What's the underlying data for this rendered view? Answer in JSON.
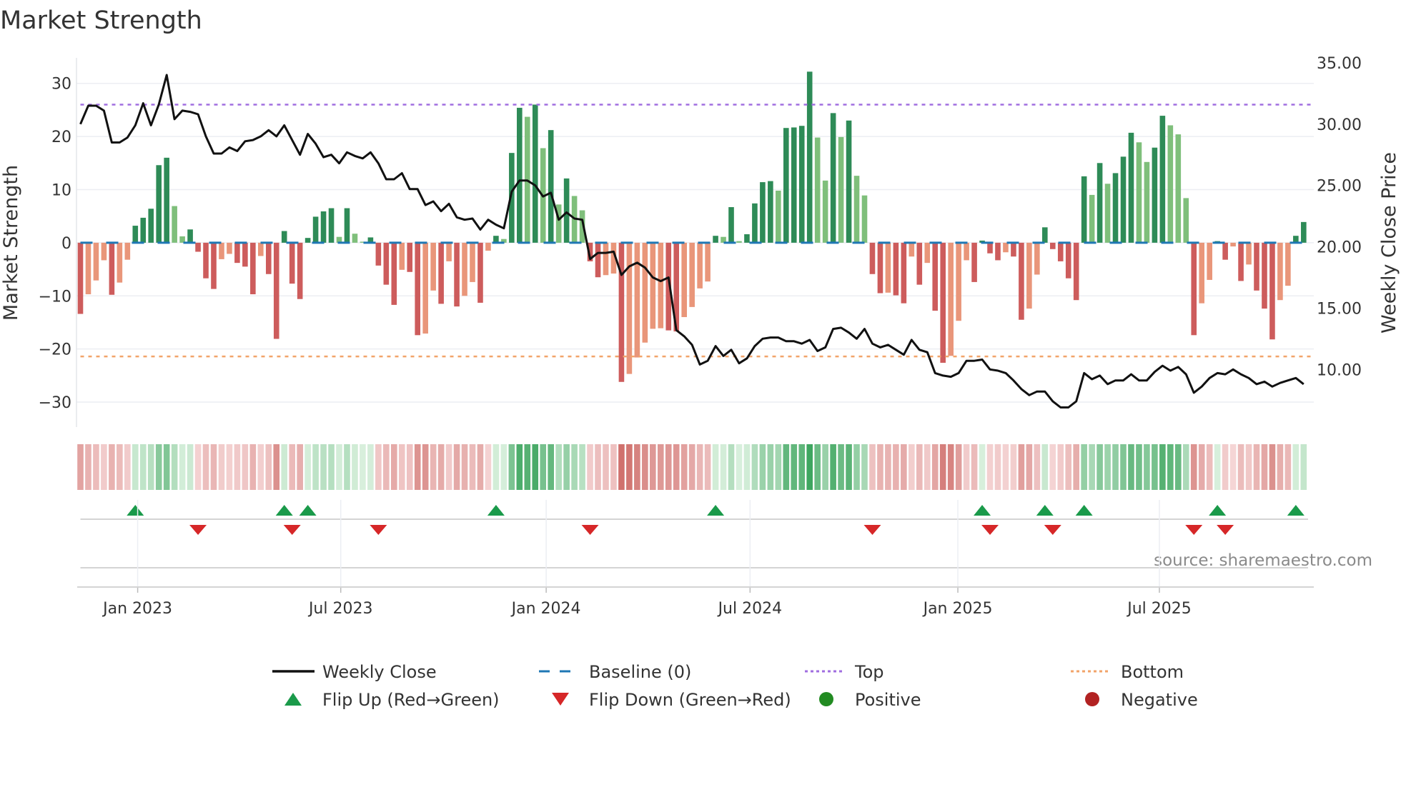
{
  "chart_data": {
    "type": "bar",
    "title": "Market Strength",
    "ylabel": "Market Strength",
    "ylabel_right": "Weekly Close Price",
    "ylim": [
      -34.7,
      34.8
    ],
    "ylim_right": [
      5.3,
      35.4
    ],
    "yticks": [
      30,
      20,
      10,
      0,
      -10,
      -20,
      -30
    ],
    "ytick_labels": [
      "30",
      "20",
      "10",
      "0",
      "−10",
      "−20",
      "−30"
    ],
    "yticks_right": [
      35,
      30,
      25,
      20,
      15,
      10
    ],
    "ytick_labels_right": [
      "35.00",
      "30.00",
      "25.00",
      "20.00",
      "15.00",
      "10.00"
    ],
    "x_unit": "week index (0 = first bar)",
    "xticks": [
      {
        "label": "Jan 2023",
        "week": 7.3
      },
      {
        "label": "Jul 2023",
        "week": 33.2
      },
      {
        "label": "Jan 2024",
        "week": 59.4
      },
      {
        "label": "Jul 2024",
        "week": 85.4
      },
      {
        "label": "Jan 2025",
        "week": 111.9
      },
      {
        "label": "Jul 2025",
        "week": 137.6
      }
    ],
    "top_level": 26,
    "bottom_level": -21.4,
    "grid": true,
    "strength": [
      -13.4,
      -9.7,
      -7.1,
      -3.3,
      -9.8,
      -7.5,
      -3.2,
      3.2,
      4.7,
      6.4,
      14.6,
      16,
      6.9,
      1.2,
      2.5,
      -1.7,
      -6.7,
      -8.7,
      -3.1,
      -2.1,
      -3.8,
      -4.5,
      -9.7,
      -2.5,
      -5.9,
      -18.1,
      2.2,
      -7.7,
      -10.6,
      0.9,
      4.9,
      5.9,
      6.5,
      1.1,
      6.5,
      1.7,
      0.2,
      1,
      -4.3,
      -7.9,
      -11.7,
      -5.1,
      -5.5,
      -17.4,
      -17.1,
      -9,
      -11.5,
      -3.5,
      -12,
      -10,
      -7.4,
      -11.3,
      -1.5,
      1.3,
      0.7,
      16.9,
      25.4,
      23.7,
      26,
      17.8,
      21.2,
      7.2,
      12.1,
      8.8,
      6.1,
      -3.5,
      -6.5,
      -6.1,
      -5.8,
      -26.2,
      -24.7,
      -21.6,
      -18.8,
      -16.2,
      -16.1,
      -16.5,
      -16.7,
      -14,
      -12.1,
      -8.6,
      -7.3,
      1.3,
      1.1,
      6.7,
      0.3,
      1.6,
      7.4,
      11.4,
      11.6,
      9.8,
      21.6,
      21.7,
      22,
      32.2,
      19.8,
      11.7,
      24.4,
      19.9,
      23,
      12.6,
      8.9,
      -5.9,
      -9.5,
      -9.4,
      -9.9,
      -11.4,
      -2.6,
      -7.9,
      -3.8,
      -12.8,
      -22.6,
      -21.3,
      -14.7,
      -3.3,
      -7.4,
      0.4,
      -2,
      -3.3,
      -1.8,
      -2.6,
      -14.5,
      -12.4,
      -6,
      2.9,
      -1.2,
      -3.5,
      -6.7,
      -10.8,
      12.5,
      9,
      15,
      11.1,
      13.1,
      16.2,
      20.7,
      18.9,
      15.2,
      17.9,
      23.9,
      22.1,
      20.4,
      8.4,
      -17.4,
      -11.4,
      -7,
      0.3,
      -3.2,
      -0.7,
      -7.2,
      -4.1,
      -9,
      -12.4,
      -18.2,
      -10.8,
      -8.1,
      1.3,
      3.9
    ],
    "weekly_close": [
      30,
      31.5,
      31.5,
      31.1,
      28.5,
      28.5,
      28.9,
      29.9,
      31.7,
      29.9,
      31.6,
      34,
      30.4,
      31.1,
      31,
      30.8,
      29,
      27.6,
      27.6,
      28.1,
      27.8,
      28.6,
      28.7,
      29,
      29.5,
      29,
      29.9,
      28.7,
      27.5,
      29.2,
      28.4,
      27.3,
      27.5,
      26.8,
      27.7,
      27.4,
      27.2,
      27.7,
      26.8,
      25.5,
      25.5,
      26,
      24.7,
      24.7,
      23.4,
      23.7,
      22.9,
      23.5,
      22.4,
      22.2,
      22.3,
      21.4,
      22.2,
      21.8,
      21.5,
      24.5,
      25.4,
      25.4,
      25,
      24.1,
      24.4,
      22.2,
      22.8,
      22.3,
      22.2,
      19,
      19.5,
      19.5,
      19.6,
      17.7,
      18.4,
      18.7,
      18.3,
      17.5,
      17.2,
      17.5,
      13.2,
      12.7,
      12,
      10.4,
      10.7,
      11.9,
      11.1,
      11.6,
      10.5,
      10.9,
      11.9,
      12.5,
      12.6,
      12.6,
      12.3,
      12.3,
      12.1,
      12.4,
      11.5,
      11.8,
      13.3,
      13.4,
      13,
      12.5,
      13.3,
      12.1,
      11.8,
      12,
      11.6,
      11.2,
      12.4,
      11.6,
      11.4,
      9.7,
      9.5,
      9.4,
      9.7,
      10.7,
      10.7,
      10.8,
      10,
      9.9,
      9.7,
      9.1,
      8.4,
      7.9,
      8.2,
      8.2,
      7.4,
      6.9,
      6.9,
      7.4,
      9.7,
      9.2,
      9.5,
      8.8,
      9.1,
      9.1,
      9.6,
      9.1,
      9.1,
      9.8,
      10.3,
      9.9,
      10.2,
      9.6,
      8.1,
      8.6,
      9.3,
      9.7,
      9.6,
      10,
      9.6,
      9.3,
      8.8,
      9,
      8.6,
      8.9,
      9.1,
      9.3,
      8.8
    ],
    "flip_up_weeks": [
      7,
      26,
      29,
      53,
      81,
      115,
      123,
      128,
      145,
      155
    ],
    "flip_down_weeks": [
      15,
      27,
      38,
      65,
      101,
      116,
      124,
      142,
      146
    ],
    "legend": {
      "placement": "bottom",
      "items": [
        {
          "label": "Weekly Close",
          "kind": "solid-line",
          "color": "#111111"
        },
        {
          "label": "Baseline (0)",
          "kind": "dashed-line",
          "color": "#1f77b4"
        },
        {
          "label": "Top",
          "kind": "dotted-line",
          "color": "#a06ee0"
        },
        {
          "label": "Bottom",
          "kind": "dotted-line",
          "color": "#f2a46a"
        },
        {
          "label": "Flip Up (Red→Green)",
          "kind": "triangle-up",
          "color": "#1a9a4a"
        },
        {
          "label": "Flip Down (Green→Red)",
          "kind": "triangle-down",
          "color": "#d62728"
        },
        {
          "label": "Positive",
          "kind": "dot",
          "color": "#228b22"
        },
        {
          "label": "Negative",
          "kind": "dot",
          "color": "#b22222"
        }
      ]
    },
    "colors": {
      "pos_strong": "#2e8b57",
      "pos_fading": "#7fbf7b",
      "neg_strong": "#cd5c5c",
      "neg_fading": "#e9967a",
      "grid": "#eceef3"
    },
    "source": "source: sharemaestro.com"
  }
}
